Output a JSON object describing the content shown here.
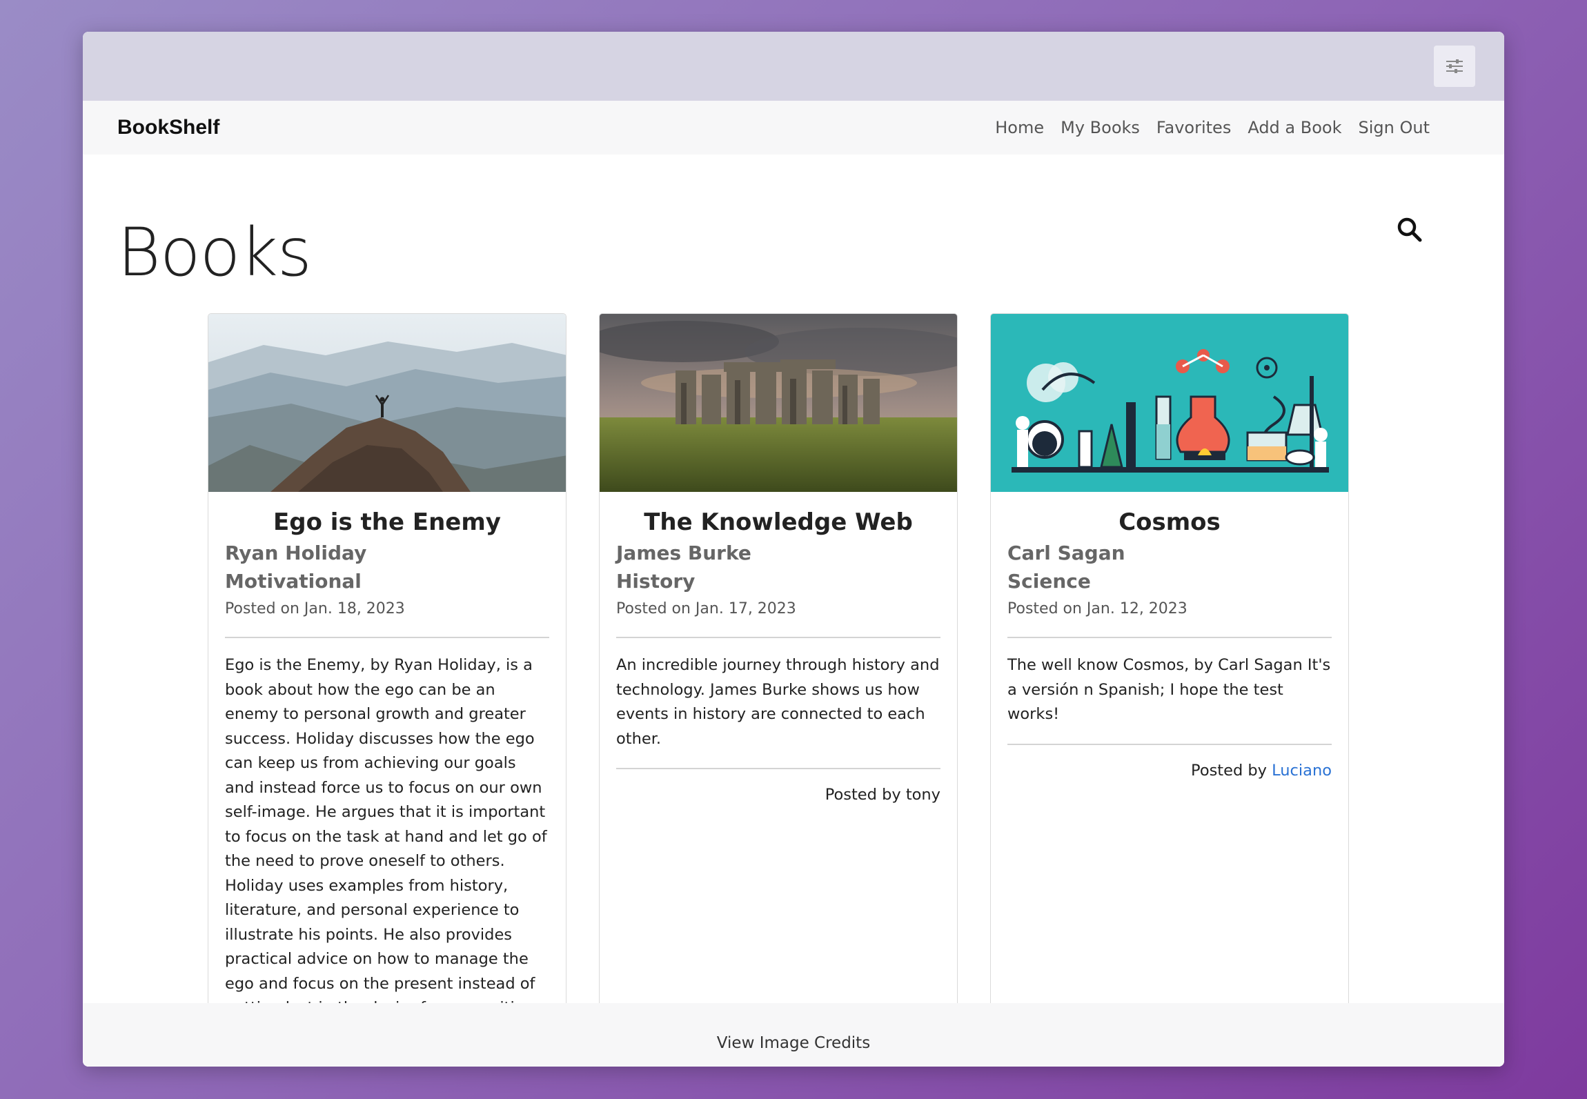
{
  "app": {
    "brand": "BookShelf",
    "nav": [
      {
        "label": "Home"
      },
      {
        "label": "My Books"
      },
      {
        "label": "Favorites"
      },
      {
        "label": "Add a Book"
      },
      {
        "label": "Sign Out"
      }
    ]
  },
  "page": {
    "title": "Books",
    "search_icon": "search-icon",
    "settings_icon": "sliders-icon"
  },
  "books": [
    {
      "title": "Ego is the Enemy",
      "author": "Ryan Holiday",
      "category": "Motivational",
      "posted": "Posted on Jan. 18, 2023",
      "description": "Ego is the Enemy, by Ryan Holiday, is a book about how the ego can be an enemy to personal growth and greater success. Holiday discusses how the ego can keep us from achieving our goals and instead force us to focus on our own self-image. He argues that it is important to focus on the task at hand and let go of the need to prove oneself to others. Holiday uses examples from history, literature, and personal experience to illustrate his points. He also provides practical advice on how to manage the ego and focus on the present instead of getting lost in the desire for recognition and reward. He encourages readers to",
      "posted_by_prefix": "",
      "posted_by_user": ""
    },
    {
      "title": "The Knowledge Web",
      "author": "James Burke",
      "category": "History",
      "posted": "Posted on Jan. 17, 2023",
      "description": "An incredible journey through history and technology. James Burke shows us how events in history are connected to each other.",
      "posted_by_prefix": "Posted by tony",
      "posted_by_user": ""
    },
    {
      "title": "Cosmos",
      "author": "Carl Sagan",
      "category": "Science",
      "posted": "Posted on Jan. 12, 2023",
      "description": "The well know Cosmos, by Carl Sagan It's a versión n Spanish; I hope the test works!",
      "posted_by_prefix": "Posted by ",
      "posted_by_user": "Luciano"
    }
  ],
  "footer": {
    "credits": "View Image Credits"
  },
  "colors": {
    "link": "#2a72d4",
    "cosmos_bg": "#2bb8b8"
  }
}
